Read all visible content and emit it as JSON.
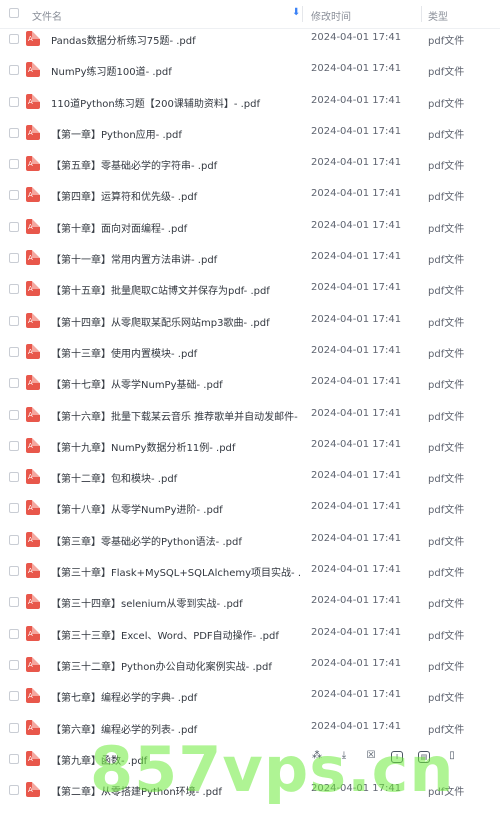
{
  "header": {
    "name_label": "文件名",
    "time_label": "修改时间",
    "type_label": "类型",
    "sort_icon": "arrow-down-icon"
  },
  "files": [
    {
      "name": "Pandas数据分析练习75题- .pdf",
      "time": "2024-04-01 17:41",
      "type": "pdf文件"
    },
    {
      "name": "NumPy练习题100道- .pdf",
      "time": "2024-04-01 17:41",
      "type": "pdf文件"
    },
    {
      "name": "110道Python练习题【200课辅助资料】- .pdf",
      "time": "2024-04-01 17:41",
      "type": "pdf文件"
    },
    {
      "name": "【第一章】Python应用- .pdf",
      "time": "2024-04-01 17:41",
      "type": "pdf文件"
    },
    {
      "name": "【第五章】零基础必学的字符串- .pdf",
      "time": "2024-04-01 17:41",
      "type": "pdf文件"
    },
    {
      "name": "【第四章】运算符和优先级- .pdf",
      "time": "2024-04-01 17:41",
      "type": "pdf文件"
    },
    {
      "name": "【第十章】面向对面编程- .pdf",
      "time": "2024-04-01 17:41",
      "type": "pdf文件"
    },
    {
      "name": "【第十一章】常用内置方法串讲- .pdf",
      "time": "2024-04-01 17:41",
      "type": "pdf文件"
    },
    {
      "name": "【第十五章】批量爬取C站博文并保存为pdf- .pdf",
      "time": "2024-04-01 17:41",
      "type": "pdf文件"
    },
    {
      "name": "【第十四章】从零爬取某配乐网站mp3歌曲- .pdf",
      "time": "2024-04-01 17:41",
      "type": "pdf文件"
    },
    {
      "name": "【第十三章】使用内置模块- .pdf",
      "time": "2024-04-01 17:41",
      "type": "pdf文件"
    },
    {
      "name": "【第十七章】从零学NumPy基础- .pdf",
      "time": "2024-04-01 17:41",
      "type": "pdf文件"
    },
    {
      "name": "【第十六章】批量下载某云音乐 推荐歌单并自动发邮件- ....",
      "time": "2024-04-01 17:41",
      "type": "pdf文件"
    },
    {
      "name": "【第十九章】NumPy数据分析11例- .pdf",
      "time": "2024-04-01 17:41",
      "type": "pdf文件"
    },
    {
      "name": "【第十二章】包和模块- .pdf",
      "time": "2024-04-01 17:41",
      "type": "pdf文件"
    },
    {
      "name": "【第十八章】从零学NumPy进阶- .pdf",
      "time": "2024-04-01 17:41",
      "type": "pdf文件"
    },
    {
      "name": "【第三章】零基础必学的Python语法- .pdf",
      "time": "2024-04-01 17:41",
      "type": "pdf文件"
    },
    {
      "name": "【第三十章】Flask+MySQL+SQLAlchemy项目实战- .pdf",
      "time": "2024-04-01 17:41",
      "type": "pdf文件"
    },
    {
      "name": "【第三十四章】selenium从零到实战- .pdf",
      "time": "2024-04-01 17:41",
      "type": "pdf文件"
    },
    {
      "name": "【第三十三章】Excel、Word、PDF自动操作- .pdf",
      "time": "2024-04-01 17:41",
      "type": "pdf文件"
    },
    {
      "name": "【第三十二章】Python办公自动化案例实战- .pdf",
      "time": "2024-04-01 17:41",
      "type": "pdf文件"
    },
    {
      "name": "【第七章】编程必学的字典- .pdf",
      "time": "2024-04-01 17:41",
      "type": "pdf文件"
    },
    {
      "name": "【第六章】编程必学的列表- .pdf",
      "time": "2024-04-01 17:41",
      "type": "pdf文件"
    },
    {
      "name": "【第九章】函数- .pdf",
      "time": "",
      "type": "",
      "hover": true
    },
    {
      "name": "【第二章】从零搭建Python环境- .pdf",
      "time": "2024-04-01 17:41",
      "type": "pdf文件"
    }
  ],
  "hover_actions": [
    "share-icon",
    "download-icon",
    "delete-icon",
    "rename-icon",
    "move-icon",
    "more-icon"
  ],
  "watermark": "857vps.cn",
  "colors": {
    "pdf_icon": "#e8574b",
    "accent": "#3b82f6",
    "watermark": "#6eeb3c"
  }
}
